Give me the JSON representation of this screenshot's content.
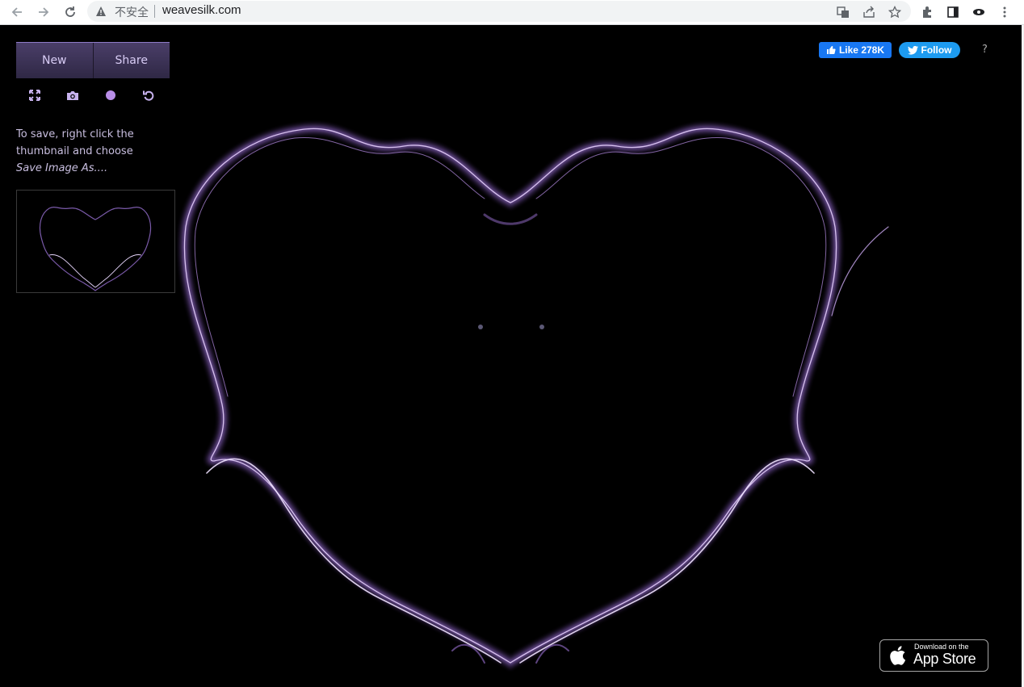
{
  "browser": {
    "security_label": "不安全",
    "url": "weavesilk.com"
  },
  "toolbar": {
    "new_label": "New",
    "share_label": "Share"
  },
  "save_hint": {
    "line1": "To save, right click the thumbnail and choose",
    "line2": "Save Image As...."
  },
  "social": {
    "like_label": "Like 278K",
    "follow_label": "Follow",
    "help_label": "?"
  },
  "appstore": {
    "small": "Download on the",
    "big": "App Store"
  },
  "colors": {
    "accent": "#b98ee8",
    "button_bg": "#3d3358",
    "background": "#000000"
  }
}
